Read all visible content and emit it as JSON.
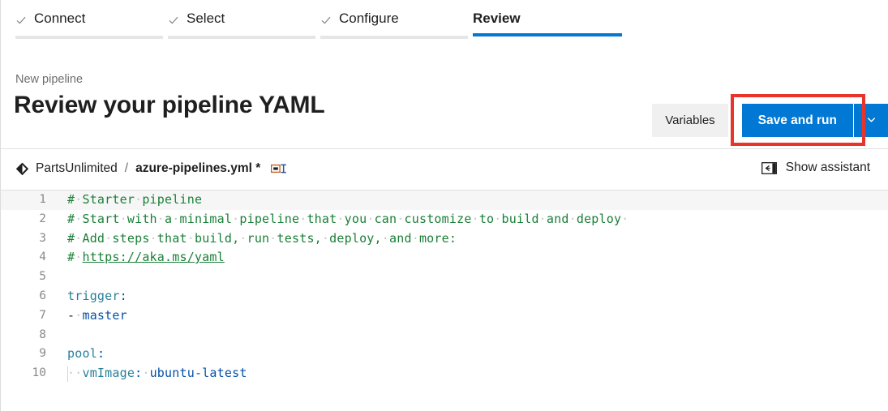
{
  "wizard": {
    "tabs": [
      {
        "label": "Connect",
        "state": "done",
        "icon": "check-icon"
      },
      {
        "label": "Select",
        "state": "done",
        "icon": "check-icon"
      },
      {
        "label": "Configure",
        "state": "done",
        "icon": "check-icon"
      },
      {
        "label": "Review",
        "state": "active",
        "icon": ""
      }
    ]
  },
  "header": {
    "breadcrumb": "New pipeline",
    "title": "Review your pipeline YAML",
    "variables_label": "Variables",
    "save_label": "Save and run",
    "chevron_icon": "chevron-down-icon",
    "highlight_color": "#e8342a",
    "accent_color": "#0078d4"
  },
  "filebar": {
    "repo_icon": "azure-repos-icon",
    "repo_name": "PartsUnlimited",
    "separator": "/",
    "file_name": "azure-pipelines.yml *",
    "rename_icon": "rename-icon",
    "assistant_icon": "show-panel-icon",
    "assistant_label": "Show assistant"
  },
  "editor": {
    "lines": [
      {
        "n": "1",
        "current": true,
        "segments": [
          {
            "t": "#",
            "c": "comment"
          },
          {
            "t": " ",
            "c": "ws"
          },
          {
            "t": "Starter",
            "c": "comment"
          },
          {
            "t": " ",
            "c": "ws"
          },
          {
            "t": "pipeline",
            "c": "comment"
          }
        ]
      },
      {
        "n": "2",
        "current": false,
        "segments": [
          {
            "t": "#",
            "c": "comment"
          },
          {
            "t": " ",
            "c": "ws"
          },
          {
            "t": "Start",
            "c": "comment"
          },
          {
            "t": " ",
            "c": "ws"
          },
          {
            "t": "with",
            "c": "comment"
          },
          {
            "t": " ",
            "c": "ws"
          },
          {
            "t": "a",
            "c": "comment"
          },
          {
            "t": " ",
            "c": "ws"
          },
          {
            "t": "minimal",
            "c": "comment"
          },
          {
            "t": " ",
            "c": "ws"
          },
          {
            "t": "pipeline",
            "c": "comment"
          },
          {
            "t": " ",
            "c": "ws"
          },
          {
            "t": "that",
            "c": "comment"
          },
          {
            "t": " ",
            "c": "ws"
          },
          {
            "t": "you",
            "c": "comment"
          },
          {
            "t": " ",
            "c": "ws"
          },
          {
            "t": "can",
            "c": "comment"
          },
          {
            "t": " ",
            "c": "ws"
          },
          {
            "t": "customize",
            "c": "comment"
          },
          {
            "t": " ",
            "c": "ws"
          },
          {
            "t": "to",
            "c": "comment"
          },
          {
            "t": " ",
            "c": "ws"
          },
          {
            "t": "build",
            "c": "comment"
          },
          {
            "t": " ",
            "c": "ws"
          },
          {
            "t": "and",
            "c": "comment"
          },
          {
            "t": " ",
            "c": "ws"
          },
          {
            "t": "deploy",
            "c": "comment"
          },
          {
            "t": " ",
            "c": "ws"
          }
        ]
      },
      {
        "n": "3",
        "current": false,
        "segments": [
          {
            "t": "#",
            "c": "comment"
          },
          {
            "t": " ",
            "c": "ws"
          },
          {
            "t": "Add",
            "c": "comment"
          },
          {
            "t": " ",
            "c": "ws"
          },
          {
            "t": "steps",
            "c": "comment"
          },
          {
            "t": " ",
            "c": "ws"
          },
          {
            "t": "that",
            "c": "comment"
          },
          {
            "t": " ",
            "c": "ws"
          },
          {
            "t": "build,",
            "c": "comment"
          },
          {
            "t": " ",
            "c": "ws"
          },
          {
            "t": "run",
            "c": "comment"
          },
          {
            "t": " ",
            "c": "ws"
          },
          {
            "t": "tests,",
            "c": "comment"
          },
          {
            "t": " ",
            "c": "ws"
          },
          {
            "t": "deploy,",
            "c": "comment"
          },
          {
            "t": " ",
            "c": "ws"
          },
          {
            "t": "and",
            "c": "comment"
          },
          {
            "t": " ",
            "c": "ws"
          },
          {
            "t": "more:",
            "c": "comment"
          }
        ]
      },
      {
        "n": "4",
        "current": false,
        "segments": [
          {
            "t": "#",
            "c": "comment"
          },
          {
            "t": " ",
            "c": "ws"
          },
          {
            "t": "https://aka.ms/yaml",
            "c": "link"
          }
        ]
      },
      {
        "n": "5",
        "current": false,
        "segments": []
      },
      {
        "n": "6",
        "current": false,
        "segments": [
          {
            "t": "trigger",
            "c": "key"
          },
          {
            "t": ":",
            "c": "punc"
          }
        ]
      },
      {
        "n": "7",
        "current": false,
        "segments": [
          {
            "t": "-",
            "c": "dash"
          },
          {
            "t": " ",
            "c": "ws"
          },
          {
            "t": "master",
            "c": "val"
          }
        ]
      },
      {
        "n": "8",
        "current": false,
        "segments": []
      },
      {
        "n": "9",
        "current": false,
        "segments": [
          {
            "t": "pool",
            "c": "key"
          },
          {
            "t": ":",
            "c": "punc"
          }
        ]
      },
      {
        "n": "10",
        "current": false,
        "indent": true,
        "segments": [
          {
            "t": "  ",
            "c": "ws"
          },
          {
            "t": "vmImage",
            "c": "key"
          },
          {
            "t": ":",
            "c": "punc"
          },
          {
            "t": " ",
            "c": "ws"
          },
          {
            "t": "ubuntu-latest",
            "c": "val"
          }
        ]
      }
    ],
    "colors": {
      "comment": "#1a7f37",
      "key": "#267f99",
      "value": "#0451a5",
      "linenumber": "#8a8a8a",
      "current_line": "#f6f6f6"
    }
  }
}
